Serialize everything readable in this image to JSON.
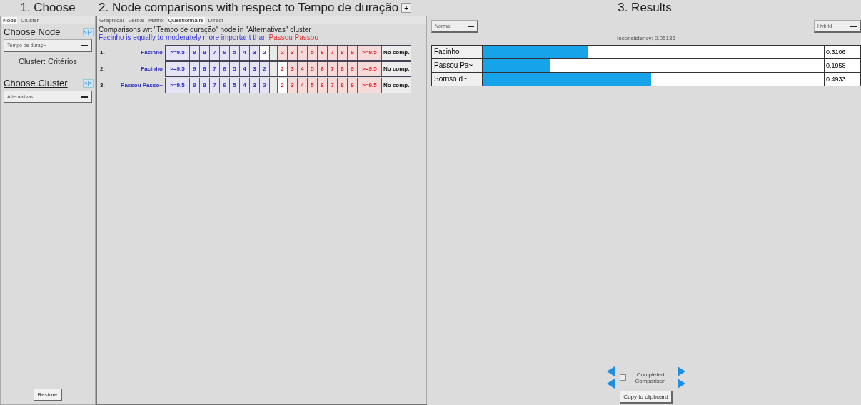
{
  "left": {
    "title": "1. Choose",
    "tabs": [
      {
        "label": "Node",
        "selected": true
      },
      {
        "label": "Cluster",
        "selected": false
      }
    ],
    "choose_node": {
      "label": "Choose Node",
      "arrow": "<|>",
      "dropdown": "Tempo de duraç~",
      "cluster": "Cluster: Critérios"
    },
    "choose_cluster": {
      "label": "Choose Cluster",
      "arrow": "<|>",
      "dropdown": "Alternativas"
    },
    "restore": "Restore"
  },
  "middle": {
    "title": "2. Node comparisons with respect to Tempo de duração",
    "title_button": "+",
    "tabs": [
      {
        "label": "Graphical",
        "selected": false
      },
      {
        "label": "Verbal",
        "selected": false
      },
      {
        "label": "Matrix",
        "selected": false
      },
      {
        "label": "Questionnaire",
        "selected": true
      },
      {
        "label": "Direct",
        "selected": false
      }
    ],
    "heading": "Comparisons wrt \"Tempo de duração\" node in \"Alternativas\" cluster",
    "statement": {
      "left": "Facinho is equally to moderately more important than",
      "right": "Passou Passou"
    },
    "rows": [
      {
        "number": "1.",
        "node": "Facinho",
        "cells": [
          {
            "label": ">=9.5",
            "kind": "first",
            "selected": false
          },
          {
            "label": "9",
            "kind": "first",
            "selected": false
          },
          {
            "label": "8",
            "kind": "first",
            "selected": false
          },
          {
            "label": "7",
            "kind": "first",
            "selected": false
          },
          {
            "label": "6",
            "kind": "first",
            "selected": false
          },
          {
            "label": "5",
            "kind": "first",
            "selected": false
          },
          {
            "label": "4",
            "kind": "first",
            "selected": false
          },
          {
            "label": "3",
            "kind": "first",
            "selected": false
          },
          {
            "label": "2",
            "kind": "first",
            "selected": true
          },
          {
            "label": "2",
            "kind": "second",
            "selected": false
          },
          {
            "label": "3",
            "kind": "second",
            "selected": false
          },
          {
            "label": "4",
            "kind": "second",
            "selected": false
          },
          {
            "label": "5",
            "kind": "second",
            "selected": false
          },
          {
            "label": "6",
            "kind": "second",
            "selected": false
          },
          {
            "label": "7",
            "kind": "second",
            "selected": false
          },
          {
            "label": "8",
            "kind": "second",
            "selected": false
          },
          {
            "label": "9",
            "kind": "second",
            "selected": false
          },
          {
            "label": ">=9.5",
            "kind": "second",
            "selected": false
          }
        ],
        "no_comp": "No comp."
      },
      {
        "number": "2.",
        "node": "Facinho",
        "cells": [
          {
            "label": ">=9.5",
            "kind": "first",
            "selected": false
          },
          {
            "label": "9",
            "kind": "first",
            "selected": false
          },
          {
            "label": "8",
            "kind": "first",
            "selected": false
          },
          {
            "label": "7",
            "kind": "first",
            "selected": false
          },
          {
            "label": "6",
            "kind": "first",
            "selected": false
          },
          {
            "label": "5",
            "kind": "first",
            "selected": false
          },
          {
            "label": "4",
            "kind": "first",
            "selected": false
          },
          {
            "label": "3",
            "kind": "first",
            "selected": false
          },
          {
            "label": "2",
            "kind": "first",
            "selected": false
          },
          {
            "label": "2",
            "kind": "second",
            "selected": true
          },
          {
            "label": "3",
            "kind": "second",
            "selected": false
          },
          {
            "label": "4",
            "kind": "second",
            "selected": false
          },
          {
            "label": "5",
            "kind": "second",
            "selected": false
          },
          {
            "label": "6",
            "kind": "second",
            "selected": false
          },
          {
            "label": "7",
            "kind": "second",
            "selected": false
          },
          {
            "label": "8",
            "kind": "second",
            "selected": false
          },
          {
            "label": "9",
            "kind": "second",
            "selected": false
          },
          {
            "label": ">=9.5",
            "kind": "second",
            "selected": false
          }
        ],
        "no_comp": "No comp."
      },
      {
        "number": "3.",
        "node": "Passou Passo~",
        "cells": [
          {
            "label": ">=9.5",
            "kind": "first",
            "selected": false
          },
          {
            "label": "9",
            "kind": "first",
            "selected": false
          },
          {
            "label": "8",
            "kind": "first",
            "selected": false
          },
          {
            "label": "7",
            "kind": "first",
            "selected": false
          },
          {
            "label": "6",
            "kind": "first",
            "selected": false
          },
          {
            "label": "5",
            "kind": "first",
            "selected": false
          },
          {
            "label": "4",
            "kind": "first",
            "selected": false
          },
          {
            "label": "3",
            "kind": "first",
            "selected": false
          },
          {
            "label": "2",
            "kind": "first",
            "selected": false
          },
          {
            "label": "2",
            "kind": "second",
            "selected": true
          },
          {
            "label": "3",
            "kind": "second",
            "selected": false
          },
          {
            "label": "4",
            "kind": "second",
            "selected": false
          },
          {
            "label": "5",
            "kind": "second",
            "selected": false
          },
          {
            "label": "6",
            "kind": "second",
            "selected": false
          },
          {
            "label": "7",
            "kind": "second",
            "selected": false
          },
          {
            "label": "8",
            "kind": "second",
            "selected": false
          },
          {
            "label": "9",
            "kind": "second",
            "selected": false
          },
          {
            "label": ">=9.5",
            "kind": "second",
            "selected": false
          }
        ],
        "no_comp": "No comp."
      }
    ]
  },
  "right": {
    "title": "3. Results",
    "mode": "Normal",
    "method": "Hybrid",
    "inconsistency": "Inconsistency: 0.05136",
    "results": [
      {
        "name": "Facinho",
        "level": 0.31061,
        "value": "0.3106"
      },
      {
        "name": "Passou Pa~",
        "level": 0.1958,
        "value": "0.1958"
      },
      {
        "name": "Sorriso d~",
        "level": 0.4933,
        "value": "0.4933"
      }
    ],
    "completed": {
      "label": "Completed Comparison",
      "checked": false
    },
    "copy": "Copy to clipboard"
  }
}
